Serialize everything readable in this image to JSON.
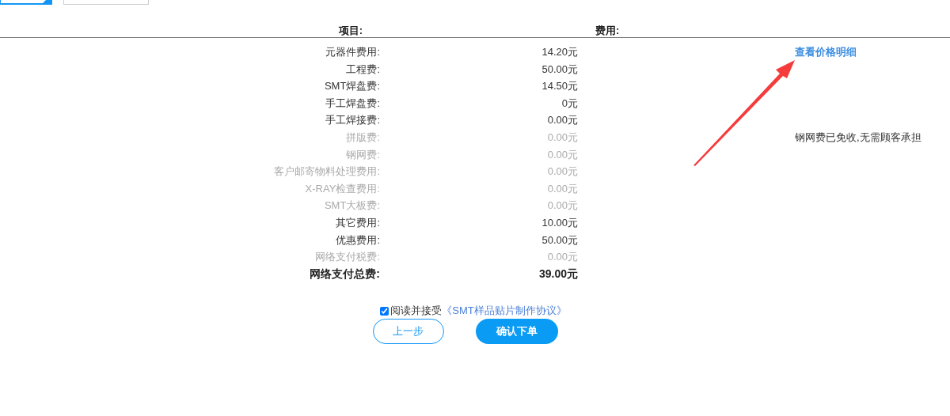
{
  "tabs": [
    {
      "selected": true
    },
    {
      "selected": false
    }
  ],
  "table": {
    "columns": [
      "项目:",
      "费用:"
    ],
    "rows": [
      {
        "kind": "item",
        "label": "元器件费用:",
        "value": "14.20元",
        "disabled": false,
        "note": {
          "kind": "link",
          "text": "查看价格明细"
        }
      },
      {
        "kind": "item",
        "label": "工程费:",
        "value": "50.00元",
        "disabled": false
      },
      {
        "kind": "item",
        "label": "SMT焊盘费:",
        "value": "14.50元",
        "disabled": false
      },
      {
        "kind": "item",
        "label": "手工焊盘费:",
        "value": "0元",
        "disabled": false
      },
      {
        "kind": "item",
        "label": "手工焊接费:",
        "value": "0.00元",
        "disabled": false
      },
      {
        "kind": "item",
        "label": "拼版费:",
        "value": "0.00元",
        "disabled": true,
        "note": {
          "kind": "text",
          "text": "钢网费已免收,无需顾客承担"
        }
      },
      {
        "kind": "item",
        "label": "钢网费:",
        "value": "0.00元",
        "disabled": true
      },
      {
        "kind": "item",
        "label": "客户邮寄物料处理费用:",
        "value": "0.00元",
        "disabled": true
      },
      {
        "kind": "item",
        "label": "X-RAY检查费用:",
        "value": "0.00元",
        "disabled": true
      },
      {
        "kind": "item",
        "label": "SMT大板费:",
        "value": "0.00元",
        "disabled": true
      },
      {
        "kind": "item",
        "label": "其它费用:",
        "value": "10.00元",
        "disabled": false
      },
      {
        "kind": "item",
        "label": "优惠费用:",
        "value": "50.00元",
        "disabled": false
      },
      {
        "kind": "item",
        "label": "网络支付税费:",
        "value": "0.00元",
        "disabled": true
      },
      {
        "kind": "total",
        "label": "网络支付总费:",
        "value": "39.00元",
        "disabled": false
      }
    ]
  },
  "agreement": {
    "checked": true,
    "text": "阅读并接受",
    "link": "《SMT样品贴片制作协议》"
  },
  "buttons": [
    {
      "kind": "secondary",
      "label": "上一步"
    },
    {
      "kind": "primary",
      "label": "确认下单"
    }
  ]
}
